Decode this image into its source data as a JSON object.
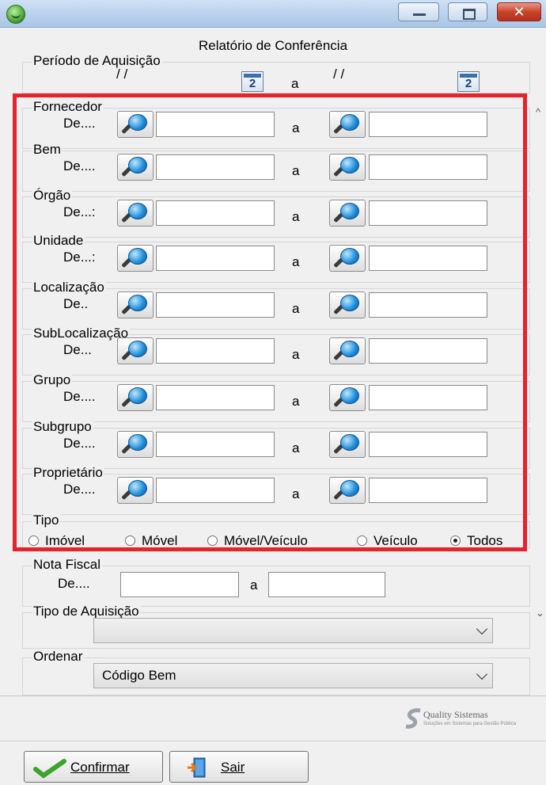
{
  "form_title": "Relatório de Conferência",
  "periodo": {
    "legend": "Período de Aquisição",
    "from_date": "/ /",
    "to_date": "/ /",
    "separator": "a",
    "calendar_day": "2"
  },
  "ranges": [
    {
      "legend": "Fornecedor",
      "from_label": "De....",
      "separator": "a"
    },
    {
      "legend": "Bem",
      "from_label": "De....",
      "separator": "a"
    },
    {
      "legend": "Órgão",
      "from_label": "De...:",
      "separator": "a"
    },
    {
      "legend": "Unidade",
      "from_label": "De...:",
      "separator": "a"
    },
    {
      "legend": "Localização",
      "from_label": "De..",
      "separator": "a"
    },
    {
      "legend": "SubLocalização",
      "from_label": "De...",
      "separator": "a"
    },
    {
      "legend": "Grupo",
      "from_label": "De....",
      "separator": "a"
    },
    {
      "legend": "Subgrupo",
      "from_label": "De....",
      "separator": "a"
    },
    {
      "legend": "Proprietário",
      "from_label": "De....",
      "separator": "a"
    }
  ],
  "tipo": {
    "legend": "Tipo",
    "options": [
      "Imóvel",
      "Móvel",
      "Móvel/Veículo",
      "Veículo",
      "Todos"
    ],
    "selected": "Todos"
  },
  "nota_fiscal": {
    "legend": "Nota Fiscal",
    "from_label": "De....",
    "separator": "a"
  },
  "tipo_aquisicao": {
    "legend": "Tipo de Aquisição",
    "value": ""
  },
  "ordenar": {
    "legend": "Ordenar",
    "value": "Código Bem"
  },
  "logo": {
    "name": "Quality Sistemas",
    "tagline": "Soluções em Sistemas para Gestão Pública"
  },
  "buttons": {
    "confirm": "Confirmar",
    "exit": "Sair"
  },
  "colors": {
    "highlight": "#e8212a",
    "titlebar": "#b9d1ec",
    "close": "#c8442c"
  }
}
